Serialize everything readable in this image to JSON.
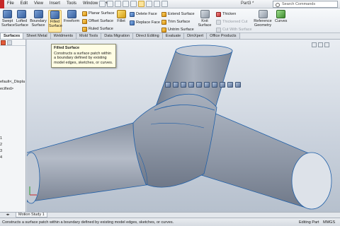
{
  "menubar": {
    "items": [
      "File",
      "Edit",
      "View",
      "Insert",
      "Tools",
      "Window",
      "Help"
    ],
    "document_title": "Part3 *",
    "search_placeholder": "Search Commands"
  },
  "ribbon": {
    "large_buttons": [
      "Swept Surface",
      "Lofted Surface",
      "Boundary Surface",
      "Filled Surface",
      "Freeform",
      "Fillet",
      "Knit Surface",
      "Reference Geometry",
      "Curves"
    ],
    "small_buttons": {
      "planar_surface": "Planar Surface",
      "offset_surface": "Offset Surface",
      "ruled_surface": "Ruled Surface",
      "delete_face": "Delete Face",
      "replace_face": "Replace Face",
      "extend_surface": "Extend Surface",
      "trim_surface": "Trim Surface",
      "untrim_surface": "Untrim Surface",
      "thicken": "Thicken",
      "thickened_cut": "Thickened Cut",
      "cut_with_surface": "Cut With Surface"
    }
  },
  "tabs": [
    "Surfaces",
    "Sheet Metal",
    "Weldments",
    "Mold Tools",
    "Data Migration",
    "Direct Editing",
    "Evaluate",
    "DimXpert",
    "Office Products"
  ],
  "active_tab": "Surfaces",
  "feature_tree": {
    "rows": [
      "efault<_Displa",
      "ecified>",
      "1",
      "2",
      "3",
      "4"
    ]
  },
  "tooltip": {
    "title": "Filled Surface",
    "body": "Constructs a surface patch within a boundary defined by existing model edges, sketches, or curves."
  },
  "bottom_tabs": [
    "Motion Study 1"
  ],
  "status": {
    "message": "Constructs a surface patch within a boundary defined by existing model edges, sketches, or curves.",
    "editing": "Editing Part",
    "units": "MMGS"
  },
  "colors": {
    "part_fill": "#8e97a6",
    "edge_line": "#1f5fa8",
    "tooltip_bg": "#fffde4",
    "active_button": "#fde9a8"
  }
}
